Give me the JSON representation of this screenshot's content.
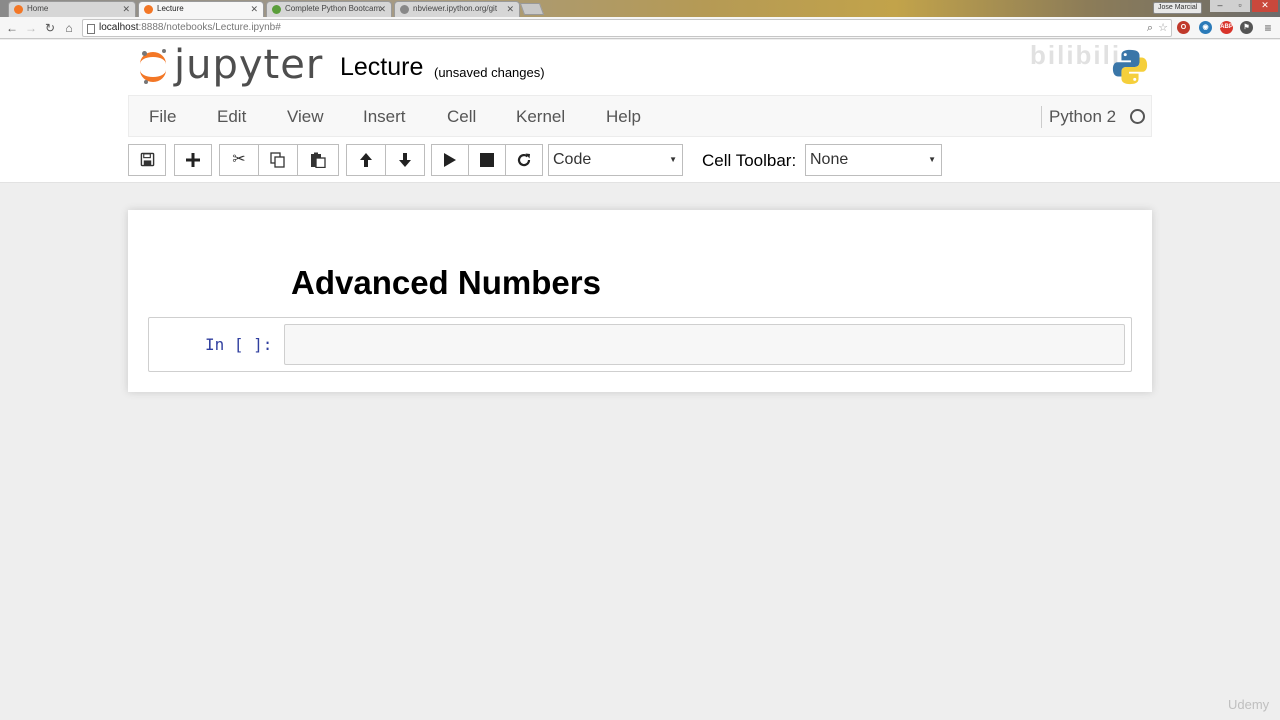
{
  "browser": {
    "tabs": [
      {
        "label": "Home",
        "active": false,
        "favicon_color": "#f37726"
      },
      {
        "label": "Lecture",
        "active": true,
        "favicon_color": "#f37726"
      },
      {
        "label": "Complete Python Bootcam",
        "active": false,
        "favicon_color": "#5a9e3a"
      },
      {
        "label": "nbviewer.ipython.org/git",
        "active": false,
        "favicon_color": "#888888"
      }
    ],
    "profile": "Jose Marcial",
    "url_host": "localhost",
    "url_rest": ":8888/notebooks/Lecture.ipynb#"
  },
  "header": {
    "logo_text": "jupyter",
    "notebook_name": "Lecture",
    "save_status": "(unsaved changes)",
    "watermark": "bilibili"
  },
  "menu": {
    "items": [
      "File",
      "Edit",
      "View",
      "Insert",
      "Cell",
      "Kernel",
      "Help"
    ],
    "kernel_name": "Python 2"
  },
  "toolbar": {
    "cell_type": "Code",
    "cell_toolbar_label": "Cell Toolbar:",
    "cell_toolbar_value": "None"
  },
  "notebook": {
    "heading": "Advanced Numbers",
    "prompt": "In [ ]:"
  },
  "footer": {
    "watermark": "Udemy"
  },
  "colors": {
    "jupyter_orange": "#f37726",
    "prompt_blue": "#303f9f"
  }
}
